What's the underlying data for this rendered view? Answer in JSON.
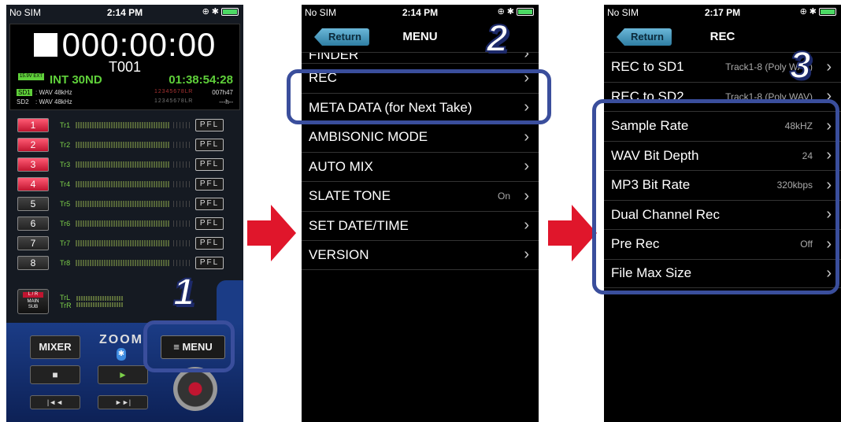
{
  "colors": {
    "accent_red": "#e0162b",
    "callout_blue": "#3a4e9c",
    "level_green": "#5fd03a"
  },
  "phone1": {
    "status": {
      "carrier": "No SIM",
      "time": "2:14 PM"
    },
    "timecode": "000:00:00",
    "take": "T001",
    "battery_label": "15.9V EXT",
    "input": "INT 30ND",
    "remaining_time": "01:38:54:28",
    "sd1": {
      "label": "SD1",
      "format": ": WAV 48kHz",
      "remaining": "007h47"
    },
    "sd2": {
      "label": "SD2",
      "format": ": WAV 48kHz",
      "remaining": "---h--"
    },
    "tracks": [
      {
        "num": "1",
        "name": "Tr1",
        "pfl": "PFL",
        "armed": true
      },
      {
        "num": "2",
        "name": "Tr2",
        "pfl": "PFL",
        "armed": true
      },
      {
        "num": "3",
        "name": "Tr3",
        "pfl": "PFL",
        "armed": true
      },
      {
        "num": "4",
        "name": "Tr4",
        "pfl": "PFL",
        "armed": true
      },
      {
        "num": "5",
        "name": "Tr5",
        "pfl": "PFL",
        "armed": false
      },
      {
        "num": "6",
        "name": "Tr6",
        "pfl": "PFL",
        "armed": false
      },
      {
        "num": "7",
        "name": "Tr7",
        "pfl": "PFL",
        "armed": false
      },
      {
        "num": "8",
        "name": "Tr8",
        "pfl": "PFL",
        "armed": false
      }
    ],
    "lr_button": {
      "top": "L / R",
      "mid": "MAIN",
      "bot": "SUB"
    },
    "lr_names": {
      "l": "TrL",
      "r": "TrR"
    },
    "mixer_label": "MIXER",
    "logo": "ZOOM",
    "menu_label": "≡ MENU",
    "stop_glyph": "■",
    "play_glyph": "►",
    "rew_glyph": "|◄◄",
    "ff_glyph": "►►|",
    "callout_number": "1"
  },
  "phone2": {
    "status": {
      "carrier": "No SIM",
      "time": "2:14 PM"
    },
    "return_label": "Return",
    "title": "MENU",
    "items": [
      {
        "label": "FINDER",
        "value": ""
      },
      {
        "label": "REC",
        "value": ""
      },
      {
        "label": "META DATA (for Next Take)",
        "value": ""
      },
      {
        "label": "AMBISONIC MODE",
        "value": ""
      },
      {
        "label": "AUTO MIX",
        "value": ""
      },
      {
        "label": "SLATE TONE",
        "value": "On"
      },
      {
        "label": "SET DATE/TIME",
        "value": ""
      },
      {
        "label": "VERSION",
        "value": ""
      }
    ],
    "callout_number": "2"
  },
  "phone3": {
    "status": {
      "carrier": "No SIM",
      "time": "2:17 PM"
    },
    "return_label": "Return",
    "title": "REC",
    "items": [
      {
        "label": "REC to SD1",
        "value": "Track1-8 (Poly WAV)"
      },
      {
        "label": "REC to SD2",
        "value": "Track1-8 (Poly WAV)"
      },
      {
        "label": "Sample Rate",
        "value": "48kHZ"
      },
      {
        "label": "WAV Bit Depth",
        "value": "24"
      },
      {
        "label": "MP3 Bit Rate",
        "value": "320kbps"
      },
      {
        "label": "Dual Channel Rec",
        "value": ""
      },
      {
        "label": "Pre Rec",
        "value": "Off"
      },
      {
        "label": "File Max Size",
        "value": ""
      }
    ],
    "callout_number": "3"
  },
  "chevron": "›"
}
